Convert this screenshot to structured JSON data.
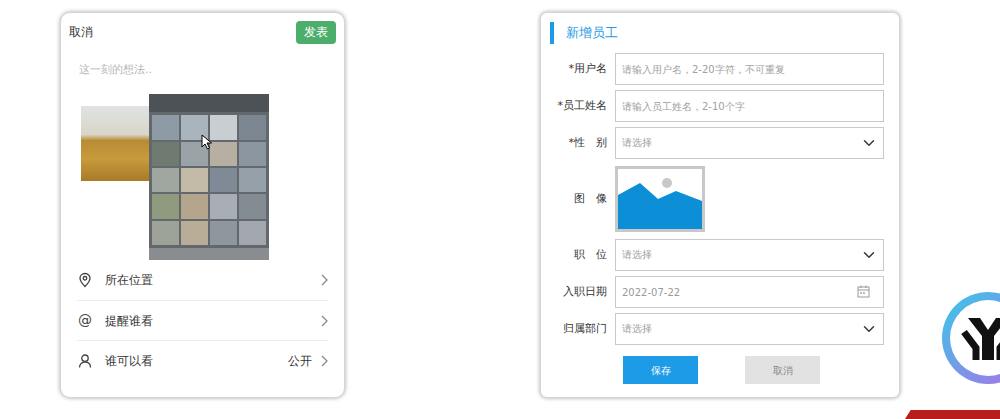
{
  "post": {
    "cancel": "取消",
    "publish": "发表",
    "placeholder": "这一刻的想法..",
    "options": [
      {
        "kind": "location",
        "label": "所在位置"
      },
      {
        "kind": "mention",
        "glyph": "@",
        "label": "提醒谁看"
      },
      {
        "kind": "audience",
        "label": "谁可以看",
        "value": "公开"
      }
    ]
  },
  "form": {
    "title": "新增员工",
    "required_mark": "*",
    "fields": [
      {
        "kind": "text",
        "label": "用户名",
        "required": true,
        "placeholder": "请输入用户名，2-20字符，不可重复"
      },
      {
        "kind": "text",
        "label": "员工姓名",
        "required": true,
        "placeholder": "请输入员工姓名，2-10个字"
      },
      {
        "kind": "select",
        "label": "性　别",
        "required": true,
        "placeholder": "请选择"
      },
      {
        "kind": "image",
        "label": "图　像",
        "required": false
      },
      {
        "kind": "select",
        "label": "职　位",
        "required": false,
        "placeholder": "请选择"
      },
      {
        "kind": "date",
        "label": "入职日期",
        "required": false,
        "value": "2022-07-22"
      },
      {
        "kind": "select",
        "label": "归属部门",
        "required": false,
        "placeholder": "请选择"
      }
    ],
    "buttons": [
      {
        "label": "保存",
        "disabled": false
      },
      {
        "label": "取消",
        "disabled": true
      }
    ]
  }
}
